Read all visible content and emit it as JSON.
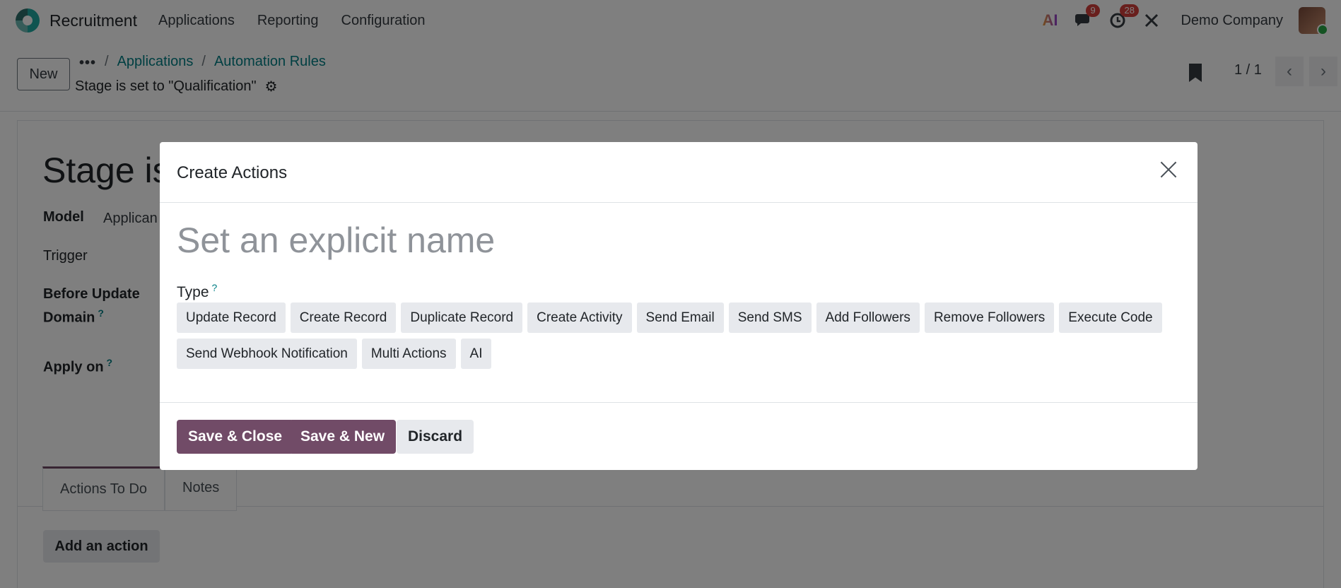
{
  "navbar": {
    "app_name": "Recruitment",
    "menu": [
      "Applications",
      "Reporting",
      "Configuration"
    ],
    "ai_label": "AI",
    "messages_count": "9",
    "activities_count": "28",
    "company": "Demo Company"
  },
  "control": {
    "new_label": "New",
    "more_label": "•••",
    "breadcrumbs": [
      "Applications",
      "Automation Rules"
    ],
    "record_title": "Stage is set to \"Qualification\"",
    "pager": "1 / 1"
  },
  "sheet": {
    "title": "Stage is",
    "model_label": "Model",
    "model_value": "Applican",
    "trigger_label": "Trigger",
    "before_update_label": "Before Update",
    "domain_label": "Domain",
    "apply_on_label": "Apply on",
    "help_mark": "?",
    "tabs": [
      "Actions To Do",
      "Notes"
    ],
    "add_action_label": "Add an action"
  },
  "modal": {
    "title": "Create Actions",
    "name_placeholder": "Set an explicit name",
    "type_label": "Type",
    "type_help": "?",
    "types": [
      "Update Record",
      "Create Record",
      "Duplicate Record",
      "Create Activity",
      "Send Email",
      "Send SMS",
      "Add Followers",
      "Remove Followers",
      "Execute Code",
      "Send Webhook Notification",
      "Multi Actions",
      "AI"
    ],
    "save_close_label": "Save & Close",
    "save_new_label": "Save & New",
    "discard_label": "Discard"
  },
  "colors": {
    "primary": "#714b67",
    "link": "#017e84",
    "badge": "#d23f3a"
  }
}
